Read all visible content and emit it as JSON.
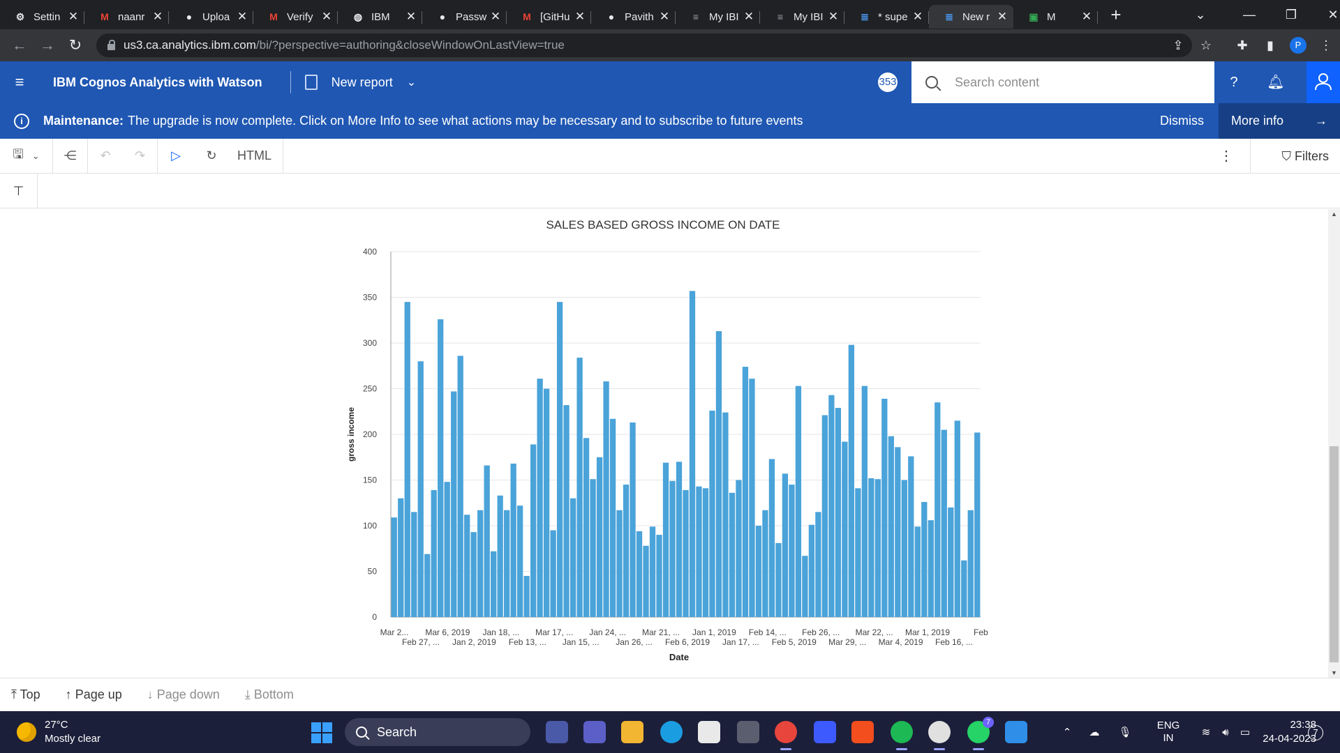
{
  "browser": {
    "tabs": [
      {
        "title": "Settin",
        "icon": "gear-icon",
        "active": false
      },
      {
        "title": "naanr",
        "icon": "gmail-icon",
        "active": false
      },
      {
        "title": "Uploa",
        "icon": "github-icon",
        "active": false
      },
      {
        "title": "Verify",
        "icon": "gmail-icon",
        "active": false
      },
      {
        "title": "IBM",
        "icon": "globe-icon",
        "active": false
      },
      {
        "title": "Passw",
        "icon": "github-icon",
        "active": false
      },
      {
        "title": "[GitHu",
        "icon": "gmail-icon",
        "active": false
      },
      {
        "title": "Pavith",
        "icon": "github-icon",
        "active": false
      },
      {
        "title": "My IBI",
        "icon": "ibm-icon",
        "active": false
      },
      {
        "title": "My IBI",
        "icon": "ibm-icon",
        "active": false
      },
      {
        "title": "* supe",
        "icon": "cognos-icon",
        "active": false
      },
      {
        "title": "New r",
        "icon": "cognos-icon",
        "active": true
      },
      {
        "title": "M",
        "icon": "meet-icon",
        "active": false
      }
    ],
    "url_host": "us3.ca.analytics.ibm.com",
    "url_path": "/bi/?perspective=authoring&closeWindowOnLastView=true",
    "profile_initial": "P"
  },
  "header": {
    "product": "IBM Cognos Analytics with Watson",
    "report_title": "New report",
    "badge": "353",
    "search_placeholder": "Search content"
  },
  "banner": {
    "label": "Maintenance:",
    "message": "The upgrade is now complete. Click on More Info to see what actions may be necessary and to subscribe to future events",
    "dismiss": "Dismiss",
    "more_info": "More info"
  },
  "toolbar": {
    "format": "HTML",
    "filters": "Filters"
  },
  "chart_data": {
    "type": "bar",
    "title": "SALES BASED GROSS INCOME ON DATE",
    "xlabel": "Date",
    "ylabel": "gross income",
    "ylim": [
      0,
      400
    ],
    "yticks": [
      0,
      50,
      100,
      150,
      200,
      250,
      300,
      350,
      400
    ],
    "grid": true,
    "xtick_labels_row1": [
      "Mar 2...",
      "Mar 6, 2019",
      "Jan 18, ...",
      "Mar 17, ...",
      "Jan 24, ...",
      "Mar 21, ...",
      "Jan 1, 2019",
      "Feb 14, ...",
      "Feb 26, ...",
      "Mar 22, ...",
      "Mar 1, 2019",
      "Feb"
    ],
    "xtick_labels_row2": [
      "Feb 27, ...",
      "Jan 2, 2019",
      "Feb 13, ...",
      "Jan 15, ...",
      "Jan 26, ...",
      "Feb 6, 2019",
      "Jan 17, ...",
      "Feb 5, 2019",
      "Mar 29, ...",
      "Mar 4, 2019",
      "Feb 16, ..."
    ],
    "values": [
      109,
      130,
      345,
      115,
      280,
      69,
      139,
      326,
      148,
      247,
      286,
      112,
      93,
      117,
      166,
      72,
      133,
      117,
      168,
      122,
      45,
      189,
      261,
      250,
      95,
      345,
      232,
      130,
      284,
      196,
      151,
      175,
      258,
      217,
      117,
      145,
      213,
      94,
      78,
      99,
      90,
      169,
      149,
      170,
      139,
      357,
      143,
      141,
      226,
      313,
      224,
      136,
      150,
      274,
      261,
      100,
      117,
      173,
      81,
      157,
      145,
      253,
      67,
      101,
      115,
      221,
      243,
      229,
      192,
      298,
      141,
      253,
      152,
      151,
      239,
      198,
      186,
      150,
      176,
      99,
      126,
      106,
      235,
      205,
      120,
      215,
      62,
      117,
      202
    ],
    "bar_color": "#4aa3d9"
  },
  "pager": {
    "top": "Top",
    "page_up": "Page up",
    "page_down": "Page down",
    "bottom": "Bottom"
  },
  "taskbar": {
    "temperature": "27°C",
    "weather": "Mostly clear",
    "search": "Search",
    "lang1": "ENG",
    "lang2": "IN",
    "time": "23:38",
    "date": "24-04-2023",
    "notifications": "7",
    "whatsapp_badge": "7"
  }
}
